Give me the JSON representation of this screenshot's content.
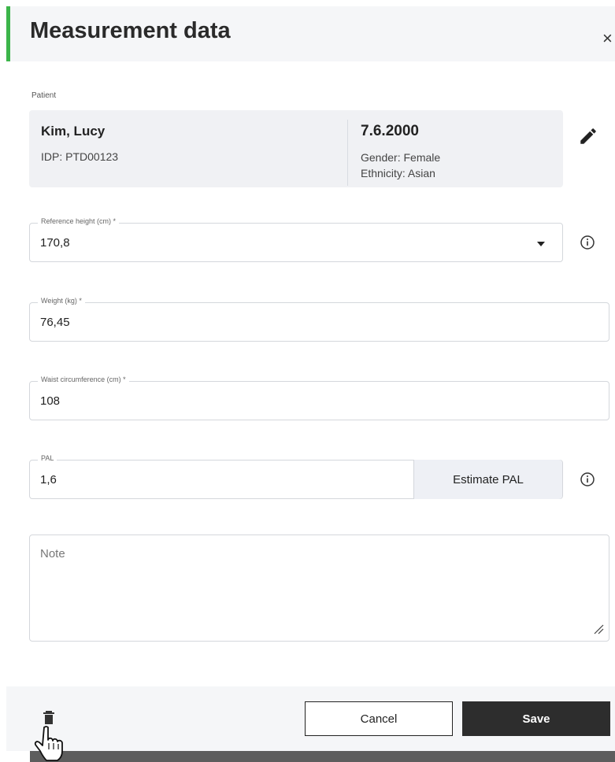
{
  "dialog": {
    "title": "Measurement data",
    "close_label": "×"
  },
  "patient": {
    "section_label": "Patient",
    "name": "Kim, Lucy",
    "idp": "IDP: PTD00123",
    "date_of_birth": "7.6.2000",
    "gender": "Gender: Female",
    "ethnicity": "Ethnicity: Asian"
  },
  "fields": {
    "reference_height": {
      "label": "Reference height (cm)  *",
      "value": "170,8"
    },
    "weight": {
      "label": "Weight (kg)  *",
      "value": "76,45"
    },
    "waist": {
      "label": "Waist circumference (cm)  *",
      "value": "108"
    },
    "pal": {
      "label": "PAL",
      "value": "1,6",
      "estimate_label": "Estimate PAL"
    },
    "note": {
      "placeholder": "Note"
    }
  },
  "footer": {
    "cancel_label": "Cancel",
    "save_label": "Save"
  },
  "colors": {
    "accent": "#3cb54a",
    "primary_button": "#2d2d2d"
  },
  "icons": [
    "close-icon",
    "pencil-icon",
    "dropdown-arrow-icon",
    "info-icon",
    "trash-icon",
    "hand-cursor-icon",
    "resize-handle-icon"
  ]
}
